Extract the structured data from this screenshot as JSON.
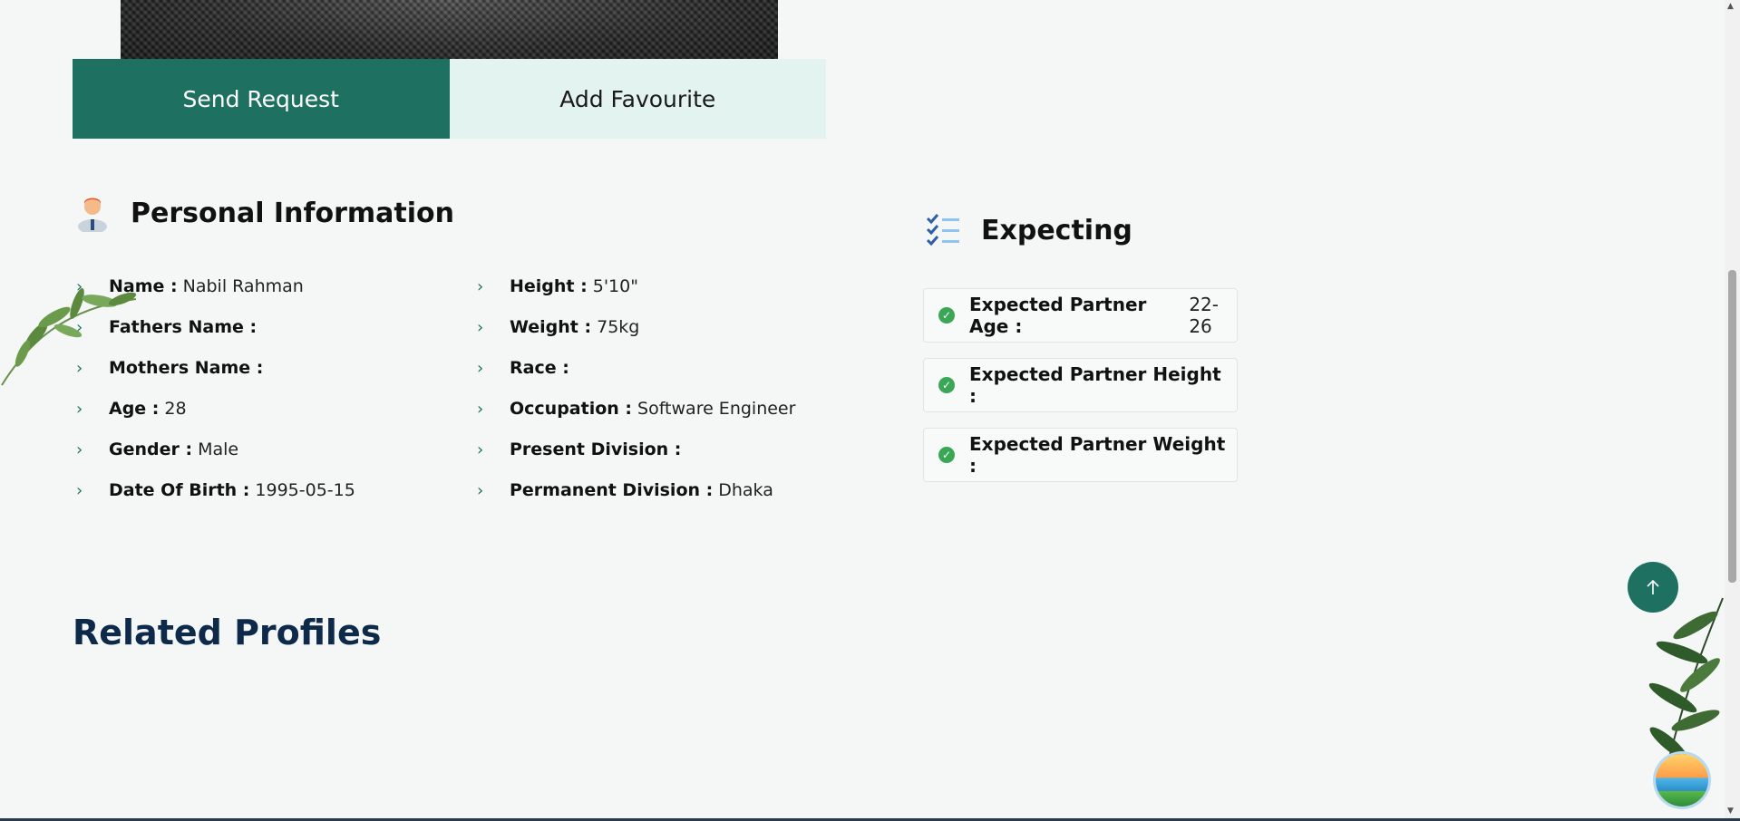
{
  "actions": {
    "send_request": "Send Request",
    "add_favourite": "Add Favourite"
  },
  "personal": {
    "title": "Personal Information",
    "left": [
      {
        "label": "Name :",
        "value": "Nabil Rahman"
      },
      {
        "label": "Fathers Name :",
        "value": ""
      },
      {
        "label": "Mothers Name :",
        "value": ""
      },
      {
        "label": "Age :",
        "value": "28"
      },
      {
        "label": "Gender :",
        "value": "Male"
      },
      {
        "label": "Date Of Birth :",
        "value": "1995-05-15"
      }
    ],
    "right": [
      {
        "label": "Height :",
        "value": "5'10\""
      },
      {
        "label": "Weight :",
        "value": "75kg"
      },
      {
        "label": "Race :",
        "value": ""
      },
      {
        "label": "Occupation :",
        "value": "Software Engineer"
      },
      {
        "label": "Present Division :",
        "value": ""
      },
      {
        "label": "Permanent Division :",
        "value": "Dhaka"
      }
    ]
  },
  "expecting": {
    "title": "Expecting",
    "items": [
      {
        "label": "Expected Partner Age :",
        "value": "22-26"
      },
      {
        "label": "Expected Partner Height :",
        "value": ""
      },
      {
        "label": "Expected Partner Weight :",
        "value": ""
      }
    ]
  },
  "related": {
    "title": "Related Profiles"
  },
  "colors": {
    "primary": "#1e7161",
    "secondary_bg": "#e3f3ef",
    "page_bg": "#f4f7f5",
    "heading_navy": "#0e2a4a",
    "check_green": "#3aa757"
  },
  "icons": {
    "personal": "person-icon",
    "expecting": "checklist-icon",
    "scroll_top": "arrow-up-icon",
    "list_bullet": "chevron-right-icon",
    "check": "check-circle-icon"
  }
}
